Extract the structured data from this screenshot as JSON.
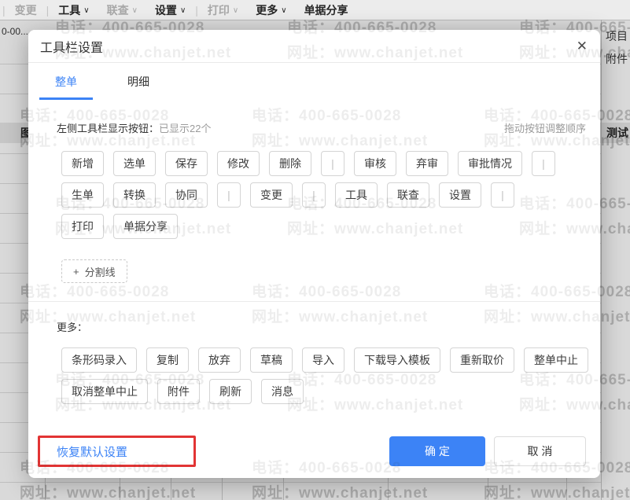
{
  "icons": {
    "caret_down": "∨",
    "close": "✕",
    "plus": "+"
  },
  "watermark": {
    "phone": "电话：400-665-0028",
    "url": "网址：www.chanjet.net"
  },
  "page_toolbar": {
    "separator": "|",
    "items": [
      {
        "type": "sep"
      },
      {
        "label": "变更",
        "disabled": true,
        "caret": false
      },
      {
        "type": "sep"
      },
      {
        "label": "工具",
        "disabled": false,
        "caret": true
      },
      {
        "label": "联查",
        "disabled": true,
        "caret": true
      },
      {
        "label": "设置",
        "disabled": false,
        "caret": true
      },
      {
        "type": "sep"
      },
      {
        "label": "打印",
        "disabled": true,
        "caret": true
      },
      {
        "label": "更多",
        "disabled": false,
        "caret": true
      },
      {
        "label": "单据分享",
        "disabled": false,
        "caret": false
      }
    ]
  },
  "background": {
    "doc_number": "0-00...",
    "side_tabs": [
      "项目",
      "附件"
    ],
    "selected_row_left": "图",
    "selected_row_right": "测试"
  },
  "dialog": {
    "title": "工具栏设置",
    "tabs": [
      {
        "label": "整单",
        "active": true
      },
      {
        "label": "明细",
        "active": false
      }
    ],
    "display_label": "左侧工具栏显示按钮：",
    "display_count": "已显示22个",
    "drag_hint": "拖动按钮调整顺序",
    "pipe_glyph": "|",
    "button_rows": [
      [
        "新增",
        "选单",
        "保存",
        "修改",
        "删除",
        "|",
        "审核",
        "弃审",
        "审批情况",
        "|"
      ],
      [
        "生单",
        "转换",
        "协同",
        "|",
        "变更",
        "|",
        "工具",
        "联查",
        "设置",
        "|"
      ],
      [
        "打印",
        "单据分享"
      ]
    ],
    "divider_button_label": "分割线",
    "more_label": "更多：",
    "more_rows": [
      [
        "条形码录入",
        "复制",
        "放弃",
        "草稿",
        "导入",
        "下载导入模板",
        "重新取价",
        "整单中止"
      ],
      [
        "取消整单中止",
        "附件",
        "刷新",
        "消息"
      ]
    ],
    "restore_link": "恢复默认设置",
    "ok_label": "确 定",
    "cancel_label": "取 消"
  },
  "colors": {
    "accent": "#3c83f6",
    "annotation": "#e23434"
  }
}
